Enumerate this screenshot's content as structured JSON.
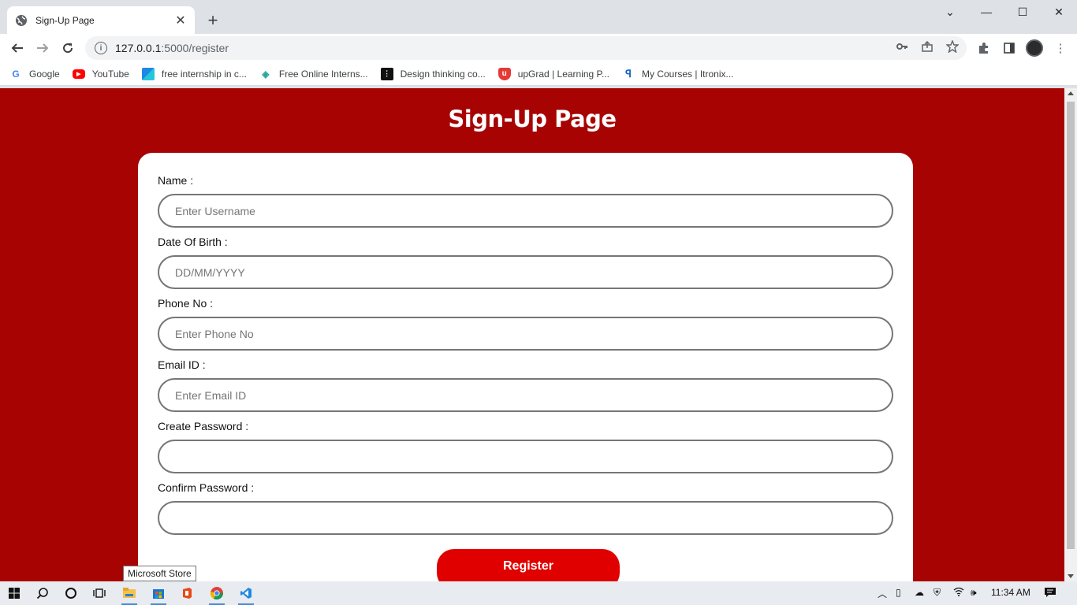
{
  "browser": {
    "tab_title": "Sign-Up Page",
    "url_host": "127.0.0.1",
    "url_path": ":5000/register",
    "bookmarks": [
      {
        "label": "Google",
        "icon": "google-icon",
        "color": "#4285f4"
      },
      {
        "label": "YouTube",
        "icon": "youtube-icon",
        "color": "#ff0000"
      },
      {
        "label": "free internship in c...",
        "icon": "internship-icon",
        "color": "#1e88e5"
      },
      {
        "label": "Free Online Interns...",
        "icon": "online-intern-icon",
        "color": "#26a69a"
      },
      {
        "label": "Design thinking co...",
        "icon": "design-icon",
        "color": "#111111"
      },
      {
        "label": "upGrad | Learning P...",
        "icon": "upgrad-icon",
        "color": "#e53935"
      },
      {
        "label": "My Courses | Itronix...",
        "icon": "itronix-icon",
        "color": "#1565c0"
      }
    ]
  },
  "page": {
    "title": "Sign-Up Page",
    "background": "#a80303",
    "fields": [
      {
        "label": "Name :",
        "placeholder": "Enter Username",
        "type": "text"
      },
      {
        "label": "Date Of Birth :",
        "placeholder": "DD/MM/YYYY",
        "type": "text"
      },
      {
        "label": "Phone No :",
        "placeholder": "Enter Phone No",
        "type": "text"
      },
      {
        "label": "Email ID :",
        "placeholder": "Enter Email ID",
        "type": "text"
      },
      {
        "label": "Create Password :",
        "placeholder": "",
        "type": "password"
      },
      {
        "label": "Confirm Password :",
        "placeholder": "",
        "type": "password"
      }
    ],
    "register_label": "Register",
    "button_color": "#e00000"
  },
  "tooltip": "Microsoft Store",
  "taskbar": {
    "time": "11:34 AM"
  }
}
